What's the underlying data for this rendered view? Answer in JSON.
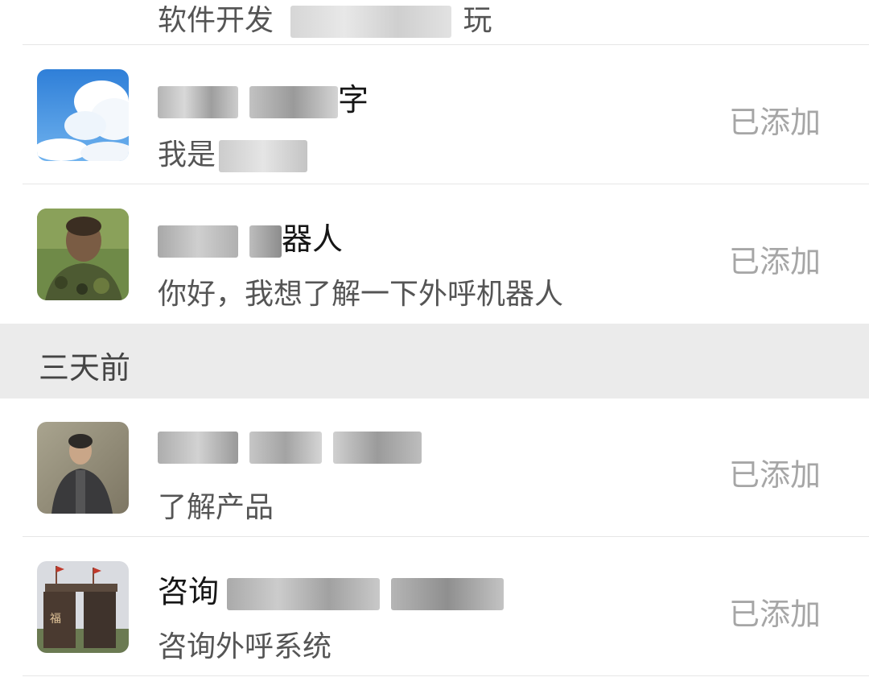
{
  "top_partial": {
    "message_visible": "软件开发",
    "message_tail": "玩"
  },
  "contacts_recent": [
    {
      "name_visible": "字",
      "message": "我是",
      "status": "已添加",
      "avatar": "sky-clouds-avatar"
    },
    {
      "name_visible": "器人",
      "message": "你好，我想了解一下外呼机器人",
      "status": "已添加",
      "avatar": "soldier-camouflage-avatar"
    }
  ],
  "section": {
    "label": "三天前"
  },
  "contacts_three_days": [
    {
      "name_visible": "",
      "message": "了解产品",
      "status": "已添加",
      "avatar": "man-portrait-avatar"
    },
    {
      "name_visible": "咨询",
      "message": "咨询外呼系统",
      "status": "已添加",
      "avatar": "gate-flags-avatar"
    }
  ],
  "colors": {
    "name_text": "#161616",
    "message_text": "#555555",
    "status_text": "#a6a6a6",
    "section_bg": "#ebebeb",
    "divider": "#e6e6e6"
  }
}
